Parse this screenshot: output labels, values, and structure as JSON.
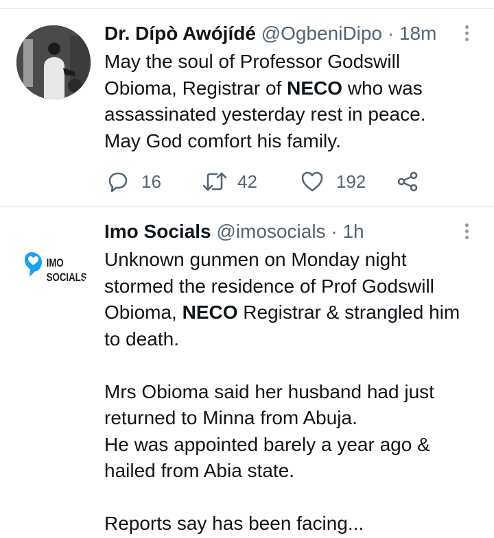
{
  "tweets": [
    {
      "name": "Dr. Dípò Awójídé",
      "handle": "@OgbeniDipo",
      "separator": "·",
      "time": "18m",
      "text_lines": {
        "l1": "May the soul of Professor Godswill",
        "l2a": "Obioma, Registrar of ",
        "l2b": "NECO",
        "l2c": " who was",
        "l3": "assassinated yesterday rest in peace.",
        "l4": "May God comfort his family."
      },
      "stats": {
        "replies": "16",
        "retweets": "42",
        "likes": "192"
      },
      "icons": {
        "reply": "reply-icon",
        "retweet": "retweet-icon",
        "like": "heart-icon",
        "share": "share-icon"
      }
    },
    {
      "name": "Imo Socials",
      "handle": "@imosocials",
      "separator": "·",
      "time": "1h",
      "avatar_text": {
        "top": "IMO",
        "bottom": "SOCIALS"
      },
      "text_lines": {
        "l1": "Unknown gunmen on Monday night",
        "l2": "stormed the residence of Prof Godswill",
        "l3a": "Obioma, ",
        "l3b": "NECO",
        "l3c": " Registrar & strangled him",
        "l4": "to death.",
        "l5": "Mrs Obioma said her husband had just",
        "l6": "returned to Minna from Abuja.",
        "l7": "He was appointed barely a year ago &",
        "l8": "hailed from Abia state.",
        "l9": "Reports say has been facing..."
      }
    }
  ],
  "colors": {
    "text": "#0f1419",
    "secondary": "#536471",
    "divider": "#e6ecf0",
    "logo_blue": "#1da1f2"
  }
}
